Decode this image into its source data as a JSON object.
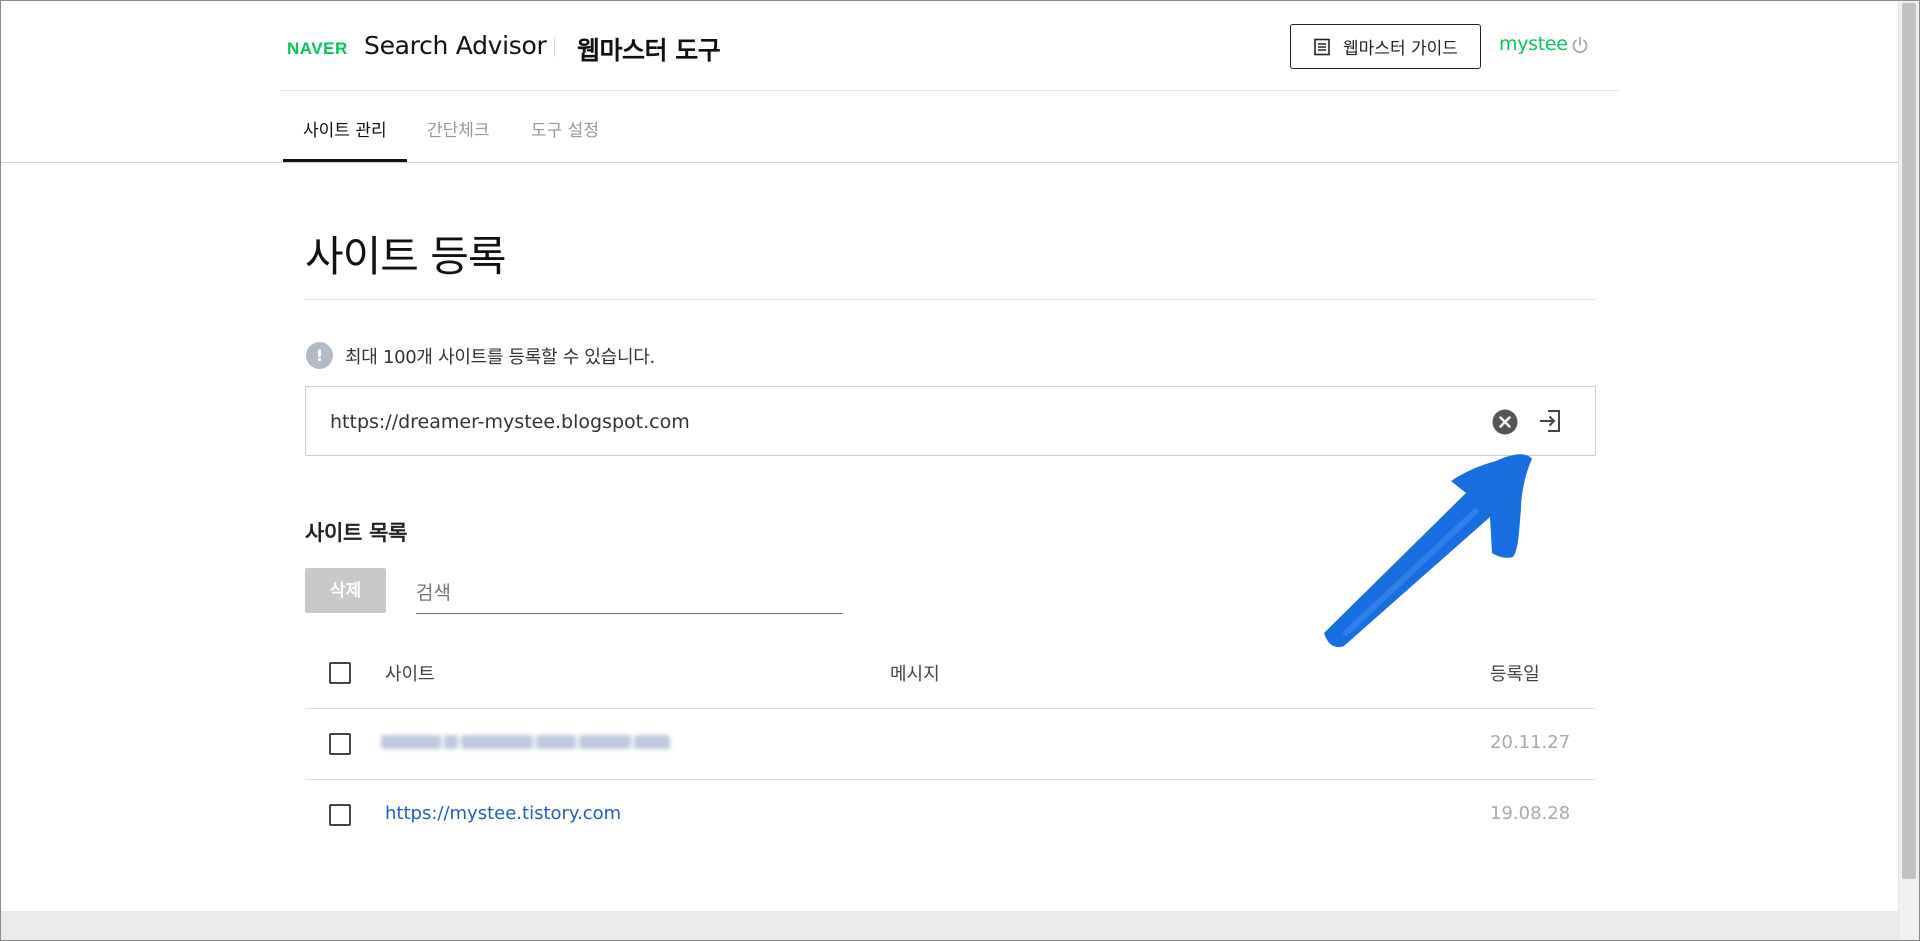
{
  "header": {
    "logo": "NAVER",
    "brand": "Search Advisor",
    "tool_name": "웹마스터 도구",
    "guide_button": "웹마스터 가이드",
    "username": "mystee"
  },
  "tabs": [
    {
      "label": "사이트 관리",
      "active": true
    },
    {
      "label": "간단체크",
      "active": false
    },
    {
      "label": "도구 설정",
      "active": false
    }
  ],
  "main": {
    "title": "사이트 등록",
    "notice": "최대 100개 사이트를 등록할 수 있습니다.",
    "url_input_value": "https://dreamer-mystee.blogspot.com"
  },
  "site_list": {
    "title": "사이트 목록",
    "delete_button": "삭제",
    "search_placeholder": "검색",
    "columns": {
      "site": "사이트",
      "message": "메시지",
      "date": "등록일"
    },
    "rows": [
      {
        "site": "",
        "date": "20.11.27",
        "blurred": true
      },
      {
        "site": "https://mystee.tistory.com",
        "date": "19.08.28",
        "blurred": false
      }
    ]
  },
  "colors": {
    "naver_green": "#03c75a",
    "link_blue": "#1d5fc4",
    "annotation_arrow": "#1a6fe0"
  },
  "icons": {
    "guide": "book-list-icon",
    "power": "power-icon",
    "notice": "exclamation-circle-icon",
    "clear": "clear-x-circle-icon",
    "submit": "enter-arrow-icon",
    "annotation": "blue-arrow-annotation"
  }
}
